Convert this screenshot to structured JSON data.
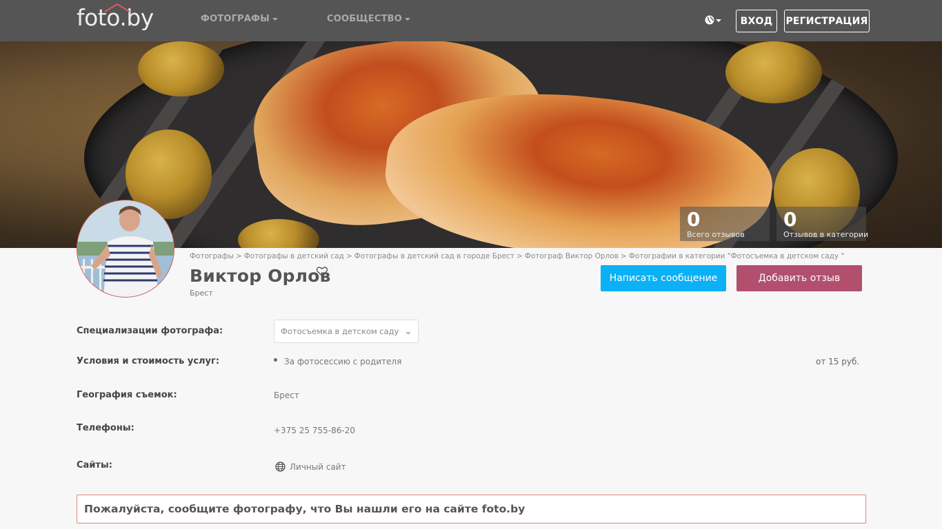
{
  "header": {
    "logo": "foto.by",
    "nav": [
      {
        "label": "ФОТОГРАФЫ"
      },
      {
        "label": "СООБЩЕСТВО"
      }
    ],
    "language_icon": "globe-icon",
    "login_label": "ВХОД",
    "register_label": "РЕГИСТРАЦИЯ"
  },
  "cover": {
    "stats": [
      {
        "value": "0",
        "label": "Всего отзывов"
      },
      {
        "value": "0",
        "label": "Отзывов в категории"
      }
    ]
  },
  "breadcrumb": [
    "Фотографы",
    "Фотографы в детский сад",
    "Фотографы в детский сад в городе Брест",
    "Фотограф Виктор Орлов",
    "Фотографии в категории \"Фотосъемка в детском саду \""
  ],
  "breadcrumb_separator": ">",
  "profile": {
    "name": "Виктор Орлов",
    "city": "Брест",
    "favorite_icon": "heart-icon"
  },
  "actions": {
    "message_label": "Написать сообщение",
    "review_label": "Добавить отзыв"
  },
  "details": {
    "specializations": {
      "label": "Специализации фотографа:",
      "selected": "Фотосъемка в детском саду"
    },
    "services": {
      "label": "Условия и стоимость услуг:",
      "item": "За фотосессию с родителя",
      "price": "от 15 руб."
    },
    "geography": {
      "label": "География съемок:",
      "value": "Брест"
    },
    "phones": {
      "label": "Телефоны:",
      "value": "+375 25 755-86-20"
    },
    "sites": {
      "label": "Сайты:",
      "link": "Личный сайт"
    }
  },
  "notice": "Пожалуйста, сообщите фотографу, что Вы нашли его на сайте foto.by",
  "colors": {
    "header_bg": "#555555",
    "message_button": "#0bb0f5",
    "review_button": "#b24f6f",
    "notice_border": "#e0827a"
  }
}
